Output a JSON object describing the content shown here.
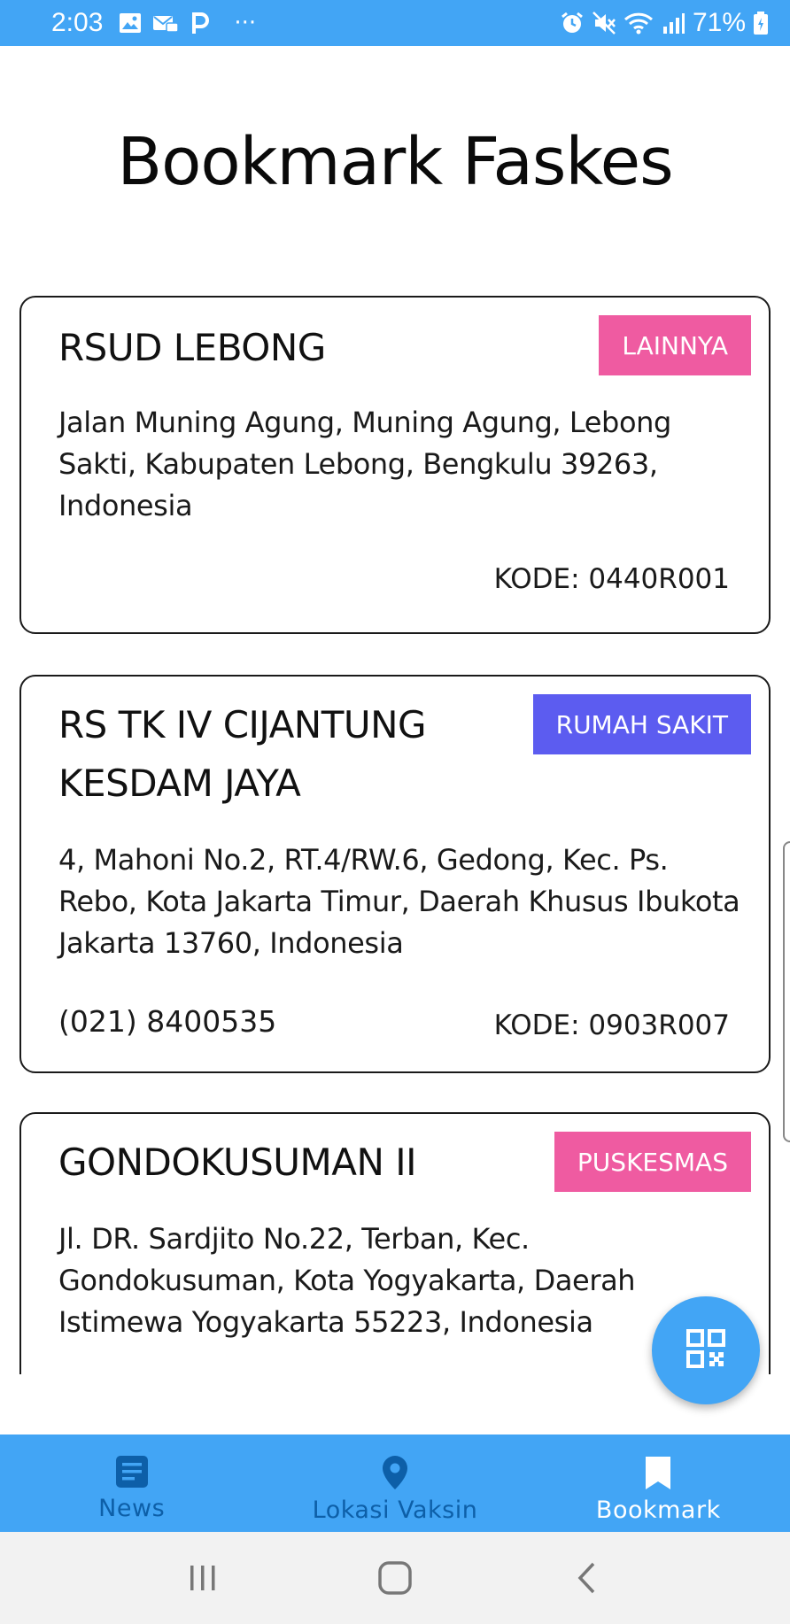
{
  "status_bar": {
    "time": "2:03",
    "more_indicator": "···",
    "battery": "71%"
  },
  "page": {
    "title": "Bookmark Faskes"
  },
  "cards": [
    {
      "name": "RSUD LEBONG",
      "badge": "LAINNYA",
      "badge_color": "#ef5ba1",
      "address": "Jalan Muning Agung, Muning Agung, Lebong Sakti, Kabupaten Lebong, Bengkulu 39263, Indonesia",
      "phone": "",
      "code": "KODE: 0440R001"
    },
    {
      "name": "RS TK IV CIJANTUNG KESDAM JAYA",
      "badge": "RUMAH SAKIT",
      "badge_color": "#5c5cf0",
      "address": "4, Mahoni No.2, RT.4/RW.6, Gedong, Kec. Ps. Rebo, Kota Jakarta Timur, Daerah Khusus Ibukota Jakarta 13760, Indonesia",
      "phone": "(021) 8400535",
      "code": "KODE: 0903R007"
    },
    {
      "name": "GONDOKUSUMAN II",
      "badge": "PUSKESMAS",
      "badge_color": "#ef5ba1",
      "address": "Jl. DR. Sardjito No.22, Terban, Kec. Gondokusuman, Kota Yogyakarta, Daerah Istimewa Yogyakarta 55223, Indonesia",
      "phone": "",
      "code": ""
    }
  ],
  "fab": {
    "icon": "qr-code-icon"
  },
  "bottom_nav": {
    "items": [
      {
        "label": "News",
        "icon": "article-icon",
        "active": false
      },
      {
        "label": "Lokasi Vaksin",
        "icon": "location-pin-icon",
        "active": false
      },
      {
        "label": "Bookmark",
        "icon": "bookmark-icon",
        "active": true
      }
    ]
  },
  "colors": {
    "primary": "#42a5f5",
    "nav_inactive": "#0d5fa8",
    "nav_active": "#ffffff"
  }
}
